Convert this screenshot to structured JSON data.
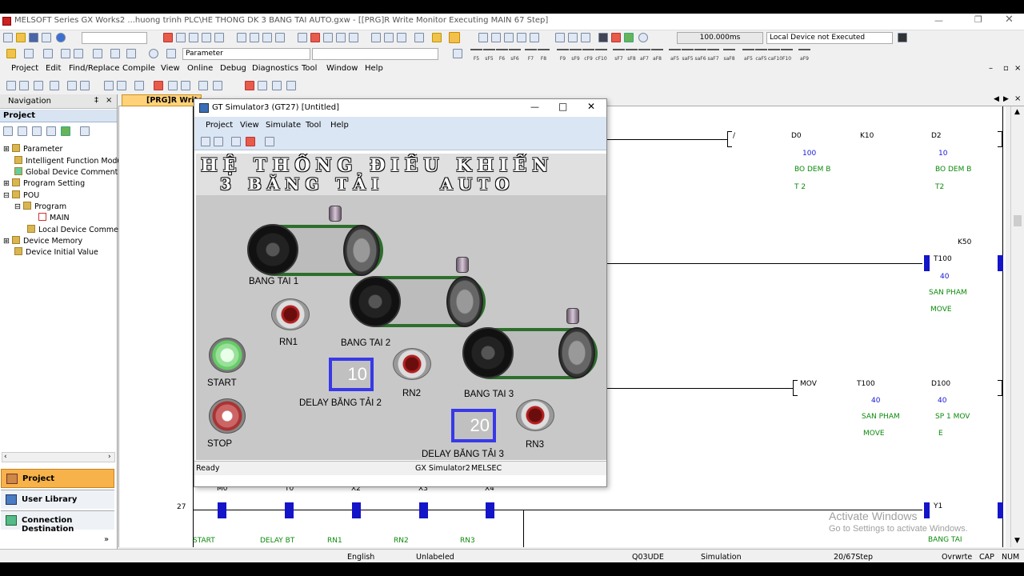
{
  "window": {
    "title": "MELSOFT Series GX Works2 ...huong trinh PLC\\HE THONG DK 3 BANG TAI AUTO.gxw - [[PRG]R Write Monitor Executing MAIN 67 Step]"
  },
  "toolbar": {
    "scan_time": "100.000ms",
    "device_status": "Local Device not Executed",
    "parameter_combo": "Parameter"
  },
  "fkeys": [
    "F5",
    "sF5",
    "F6",
    "sF6",
    "F7",
    "F8",
    "F9",
    "sF9",
    "cF9",
    "cF10",
    "sF7",
    "sF8",
    "aF7",
    "aF8",
    "aF5",
    "saF5",
    "saF6",
    "saF7",
    "saF8",
    "aF5",
    "caF5",
    "caF10",
    "F10",
    "aF9"
  ],
  "menu": [
    "Project",
    "Edit",
    "Find/Replace",
    "Compile",
    "View",
    "Online",
    "Debug",
    "Diagnostics",
    "Tool",
    "Window",
    "Help"
  ],
  "navigation": {
    "header": "Navigation",
    "pin": "I ×",
    "section": "Project",
    "tree": [
      "Parameter",
      "Intelligent Function Modu",
      "Global Device Comment",
      "Program Setting",
      "POU",
      "Program",
      "MAIN",
      "Local Device Commen",
      "Device Memory",
      "Device Initial Value"
    ],
    "bottom": [
      "Project",
      "User Library",
      "Connection Destination"
    ]
  },
  "editor_tab": "[PRG]R Write",
  "ladder": {
    "r1": {
      "slash": "/",
      "d0": "D0",
      "k10": "K10",
      "d2": "D2",
      "v100": "100",
      "v10": "10",
      "c1": "BO DEM B",
      "c2": "BO DEM B",
      "t1": "T 2",
      "t2": "T2"
    },
    "r2": {
      "k50": "K50",
      "t100": "T100",
      "v40": "40",
      "c1": "SAN PHAM",
      "c2": "MOVE"
    },
    "r3": {
      "mov": "MOV",
      "t100": "T100",
      "d100": "D100",
      "v1": "40",
      "v2": "40",
      "c1": "SAN PHAM",
      "c2": "MOVE",
      "c3": "SP 1 MOV",
      "c4": "E"
    },
    "r4": {
      "step": "27",
      "m0": "M0",
      "t0": "T0",
      "x2": "X2",
      "x3": "X3",
      "x4": "X4",
      "y1": "Y1",
      "c_m0": "START",
      "c_t0": "DELAY BT",
      "c_x2": "RN1",
      "c_x3": "RN2",
      "c_x4": "RN3",
      "c_y1": "BANG TAI"
    }
  },
  "gt": {
    "title": "GT Simulator3 (GT27)  [Untitled]",
    "menu": [
      "Project",
      "View",
      "Simulate",
      "Tool",
      "Help"
    ],
    "heading1": "HỆ THỐNG ĐIỀU KHIỂN",
    "heading2": "3 BĂNG TẢI     AUTO",
    "labels": {
      "bt1": "BANG TAI 1",
      "bt2": "BANG TAI 2",
      "bt3": "BANG TAI 3",
      "rn1": "RN1",
      "rn2": "RN2",
      "rn3": "RN3",
      "start": "START",
      "stop": "STOP",
      "delay2": "DELAY BĂNG TẢI 2",
      "delay3": "DELAY BĂNG TẢI 3"
    },
    "delay2_value": "10",
    "delay3_value": "20",
    "status": {
      "ready": "Ready",
      "sim": "GX Simulator2",
      "melsec": "MELSEC"
    }
  },
  "watermark": {
    "line1": "Activate Windows",
    "line2": "Go to Settings to activate Windows."
  },
  "statusbar": {
    "lang": "English",
    "label": "Unlabeled",
    "cpu": "Q03UDE",
    "mode": "Simulation",
    "step": "20/67Step",
    "ovr": "Ovrwrte",
    "cap": "CAP",
    "num": "NUM"
  }
}
